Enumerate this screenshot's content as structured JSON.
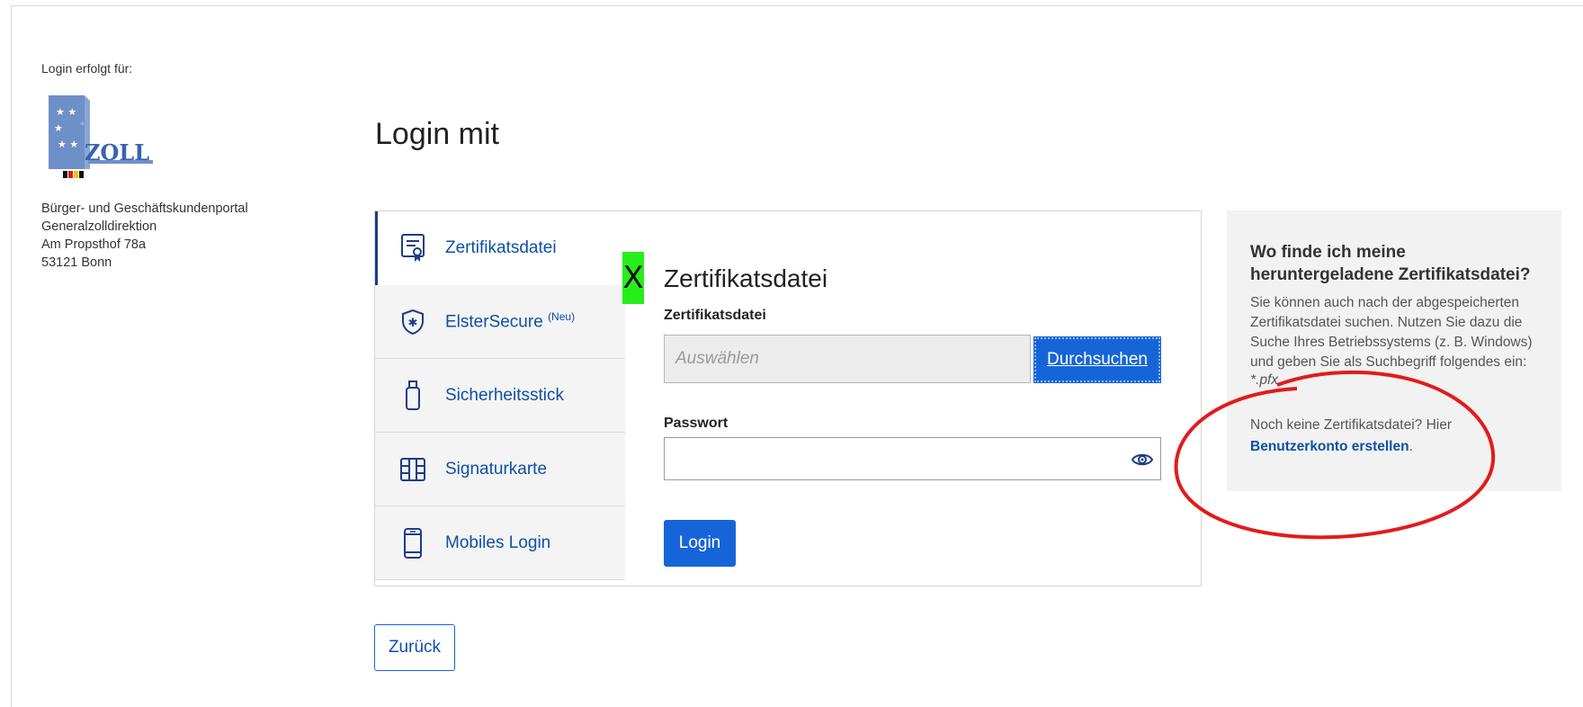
{
  "sidebar": {
    "login_for_label": "Login erfolgt für:",
    "logo_text": "ZOLL",
    "address_lines": [
      "Bürger- und Geschäftskundenportal",
      "Generalzolldirektion",
      "Am Propsthof 78a",
      "53121 Bonn"
    ]
  },
  "main": {
    "title": "Login mit",
    "tabs": [
      {
        "label": "Zertifikatsdatei",
        "icon": "certificate-icon",
        "active": true
      },
      {
        "label": "ElsterSecure",
        "badge": "(Neu)",
        "icon": "shield-star-icon",
        "active": false
      },
      {
        "label": "Sicherheitsstick",
        "icon": "usb-stick-icon",
        "active": false
      },
      {
        "label": "Signaturkarte",
        "icon": "chip-card-icon",
        "active": false
      },
      {
        "label": "Mobiles Login",
        "icon": "mobile-phone-icon",
        "active": false
      }
    ],
    "form": {
      "marker": "X",
      "title": "Zertifikatsdatei",
      "file_label": "Zertifikatsdatei",
      "file_placeholder": "Auswählen",
      "browse_label": "Durchsuchen",
      "password_label": "Passwort",
      "password_value": "",
      "login_label": "Login"
    },
    "back_label": "Zurück"
  },
  "help": {
    "title": "Wo finde ich meine heruntergeladene Zertifikatsdatei?",
    "text": "Sie können auch nach der abgespeicherten Zertifikatsdatei suchen. Nutzen Sie dazu die Suche Ihres Betriebssystems (z. B. Windows) und geben Sie als Suchbegriff folgendes ein:",
    "search_term": "*.pfx",
    "note": "Noch keine Zertifikatsdatei? Hier",
    "link_label": "Benutzerkonto erstellen",
    "link_suffix": "."
  },
  "colors": {
    "accent": "#1665d8",
    "link": "#0f4fa8",
    "active_tab_bar": "#1f3c88",
    "annotation": "#e31b1b",
    "marker_bg": "#27ee1b"
  }
}
